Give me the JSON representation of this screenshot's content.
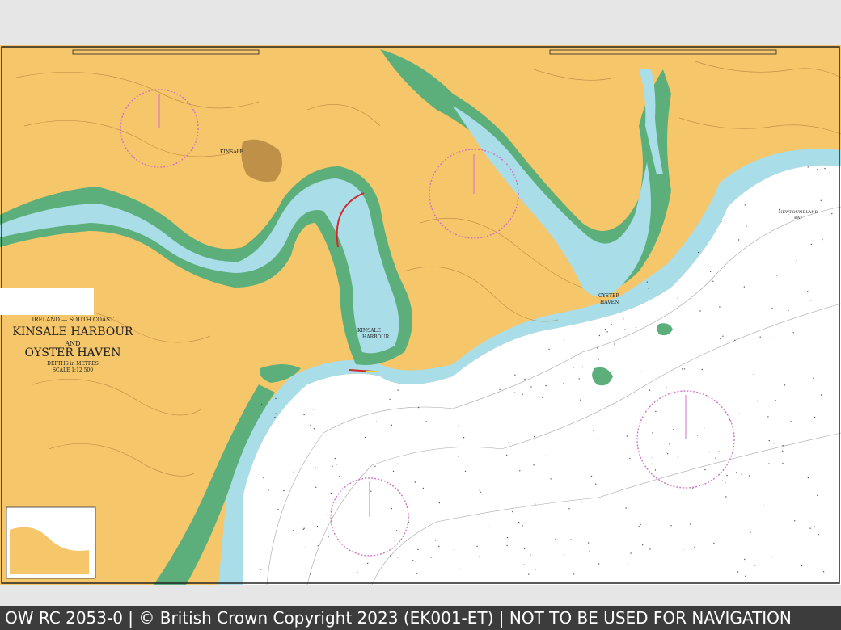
{
  "chart": {
    "region": "IRELAND — SOUTH COAST",
    "title_line1": "KINSALE HARBOUR",
    "title_line2": "AND",
    "title_line3": "OYSTER HAVEN",
    "depths": "DEPTHS in METRES",
    "scale": "SCALE 1:12 500"
  },
  "places": {
    "kinsale": "KINSALE",
    "kinsale_harbour_1": "KINSALE",
    "kinsale_harbour_2": "HARBOUR",
    "oyster_haven_1": "OYSTER",
    "oyster_haven_2": "HAVEN",
    "newfoundland_bay_1": "NEWFOUNDLAND",
    "newfoundland_bay_2": "BAY"
  },
  "footer": {
    "caption": "OW RC 2053-0 | © British Crown Copyright 2023 (EK001-ET) | NOT TO BE USED FOR NAVIGATION"
  },
  "colors": {
    "land": "#f6c76a",
    "shallow_water": "#a9dde8",
    "drying_zone": "#5caf7a",
    "deep_water": "#ffffff",
    "compass_rose": "#d070c8",
    "caption_bg": "#3c3c3c"
  },
  "icons": {
    "compass_rose": "compass-rose-icon"
  }
}
